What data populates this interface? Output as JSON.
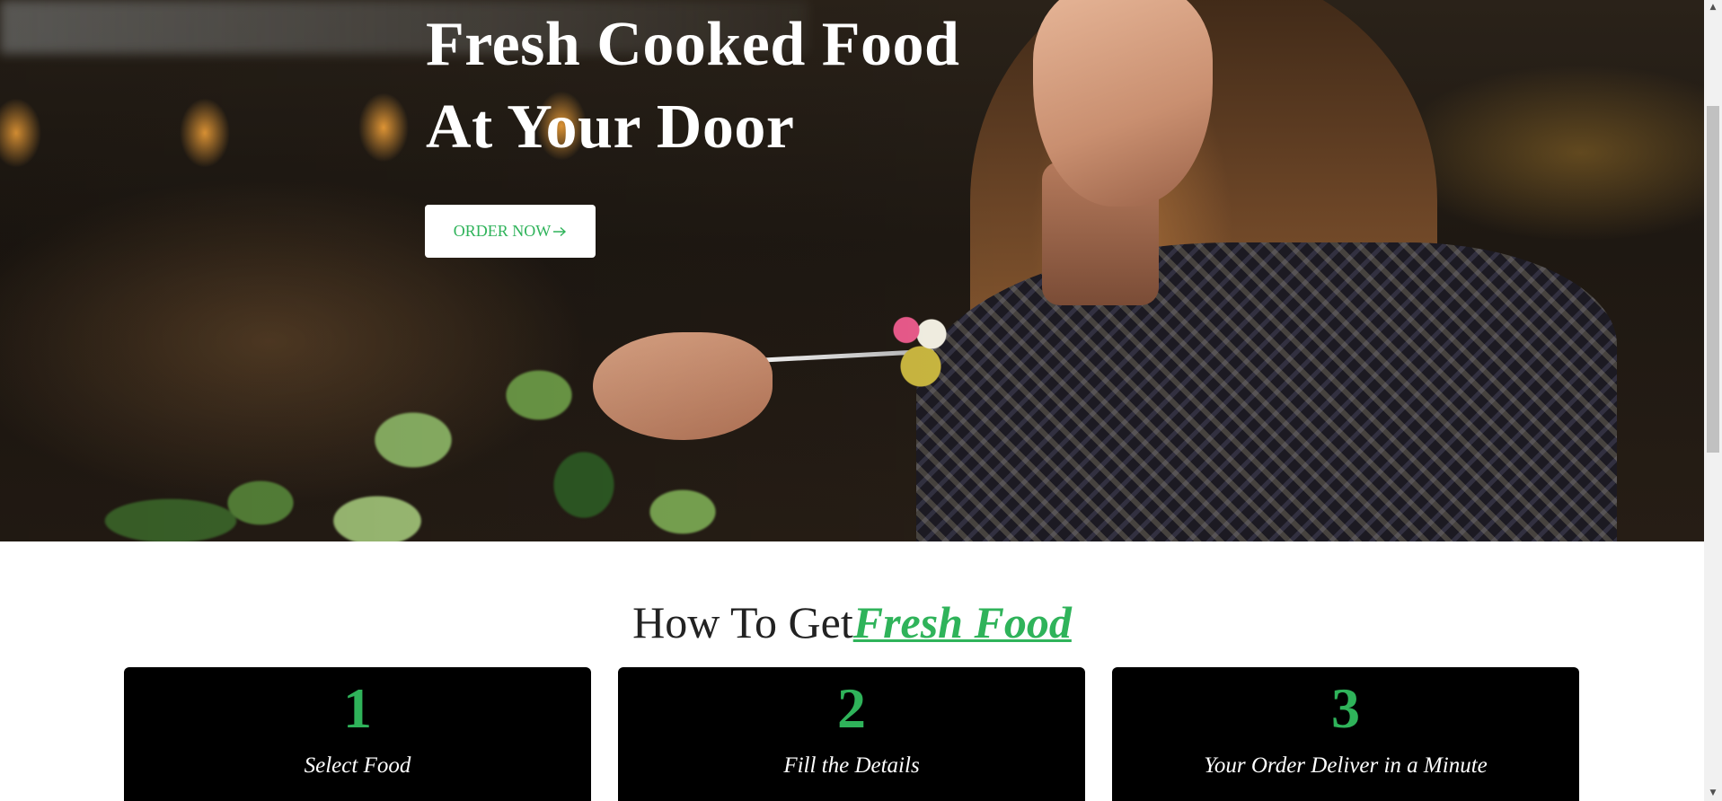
{
  "hero": {
    "title_line1": "Fresh Cooked Food",
    "title_line2": "At Your Door",
    "order_button_label": "ORDER NOW",
    "order_button_icon": "arrow-right-icon"
  },
  "howto": {
    "heading_prefix": "How To Get",
    "heading_accent": "Fresh Food",
    "steps": [
      {
        "number": "1",
        "label": "Select Food"
      },
      {
        "number": "2",
        "label": "Fill the Details"
      },
      {
        "number": "3",
        "label": "Your Order Deliver in a Minute"
      }
    ]
  },
  "colors": {
    "accent": "#2fb35a",
    "card_background": "#000000",
    "hero_text": "#ffffff"
  },
  "scrollbar": {
    "up_icon": "scroll-up-arrow-icon",
    "down_icon": "scroll-down-arrow-icon"
  }
}
